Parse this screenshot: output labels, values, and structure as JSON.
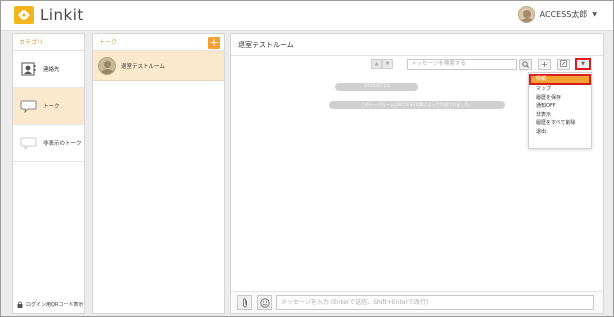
{
  "app": {
    "brand": "Linkit",
    "user_name": "ACCESS太郎",
    "colors": {
      "accent": "#f2a230",
      "highlight": "#fbe9cd",
      "annotation": "#d91e1e"
    }
  },
  "category_panel": {
    "title": "カテゴリ",
    "items": [
      {
        "label": "連絡先",
        "icon": "contacts-icon"
      },
      {
        "label": "トーク",
        "icon": "speech-bubble-icon",
        "active": true
      },
      {
        "label": "非表示のトーク",
        "icon": "hidden-bubble-icon"
      }
    ],
    "qr_label": "ログイン用QRコード表示"
  },
  "talk_panel": {
    "title": "トーク",
    "items": [
      {
        "name": "退室テストルーム"
      }
    ]
  },
  "room": {
    "title": "退室テストルーム",
    "search_placeholder": "メッセージを検索する",
    "date": "2024.07.23",
    "system_message": "このトークルームはACCESS太郎によって作成されました。",
    "composer_placeholder": "メッセージを入力 (Enterで送信、Shift+Enterで改行)",
    "menu_items": [
      "情報",
      "マップ",
      "履歴を保存",
      "通知OFF",
      "非表示",
      "履歴をすべて削除",
      "退出"
    ]
  }
}
